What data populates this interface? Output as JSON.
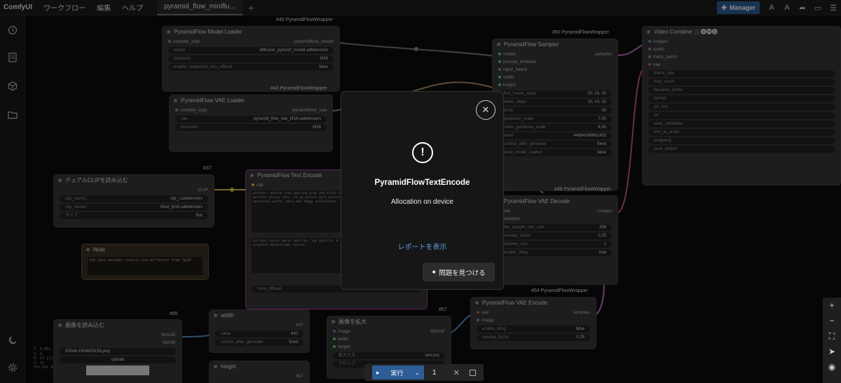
{
  "menubar": {
    "logo": "ComfyUI",
    "items": [
      "ワークフロー",
      "編集",
      "ヘルプ"
    ],
    "tab": "pyramid_flow_miniflu...",
    "plus": "+",
    "manager": "Manager"
  },
  "stats": [
    "T: 0.00s",
    "I: 0",
    "N: 13 [13]",
    "V: 31",
    "FPS:147.06"
  ],
  "nodes": {
    "model_loader": {
      "badge": "#40 PyramidFlowWrapper",
      "title": "PyramidFlow Model Loader",
      "in": "compile_args",
      "out": "pyramidflow_model",
      "w": [
        [
          "model",
          "diffusion_pytorch_model.safetensors"
        ],
        [
          "precision",
          "bf16"
        ],
        [
          "enable_sequential_cpu_offload",
          "false"
        ]
      ]
    },
    "vae_loader": {
      "badge": "#43 PyramidFlowWrapper",
      "title": "PyramidFlow VAE Loader",
      "in": "compile_args",
      "out": "pyramidflow_vae",
      "w": [
        [
          "vae",
          "pyramid_flow_vae_bf16.safetensors"
        ],
        [
          "precision",
          "bf16"
        ]
      ]
    },
    "dual_clip": {
      "badge": "#37",
      "title": "デュアルCLIPを読み込む",
      "out": "CLIP",
      "w": [
        [
          "clip_name1",
          "clip_l.safetensors"
        ],
        [
          "clip_name2",
          "t5xxl_fp16.safetensors"
        ],
        [
          "タイプ",
          "flux"
        ]
      ]
    },
    "text_encode": {
      "title": "PyramidFlow Text Encode",
      "in": "clip",
      "pos": "outdoor, medium shot,wearing gray and black cut hair), wide hip, large breasts, perfect glossy skin ,25 yo mature girl,picture of a asian beauty, Machine background , spaceship parts, dark and foggy environment, heavy fog",
      "neg": "cartoon style, worst quality, low quality, b low res, extra limbs, extra digits, misplace monochrome, horror",
      "w": "fcme_offload"
    },
    "note": {
      "title": "Note",
      "text": "fp8 text encoder results are different from fp16!"
    },
    "sampler": {
      "badge": "#50 PyramidFlowWrapper",
      "title": "PyramidFlow Sampler",
      "ins": [
        "model",
        "prompt_embeds",
        "input_latent",
        "width",
        "height"
      ],
      "out": "samples",
      "w": [
        [
          "first_frame_steps",
          "20, 20, 20"
        ],
        [
          "video_steps",
          "10, 10, 10"
        ],
        [
          "temp",
          "16"
        ],
        [
          "guidance_scale",
          "7.00"
        ],
        [
          "video_guidance_scale",
          "4.00"
        ],
        [
          "seed",
          "44664248661402"
        ],
        [
          "control_after_generate",
          "fixed"
        ],
        [
          "keep_model_loaded",
          "false"
        ]
      ]
    },
    "video_combine": {
      "title": "Video Combine 🎥🅥🅗🅢",
      "ins": [
        "images",
        "audio",
        "meta_batch",
        "vae"
      ],
      "w": [
        "frame_rate",
        "loop_count",
        "filename_prefix",
        "format",
        "pix_fmt",
        "crf",
        "save_metadata",
        "trim_to_audio",
        "pingpong",
        "save_output"
      ]
    },
    "vae_decode": {
      "badge": "#48 PyramidFlowWrapper",
      "title": "PyramidFlow VAE Decode",
      "ins": [
        "vae",
        "samples"
      ],
      "out": "images",
      "w": [
        [
          "tile_sample_min_size",
          "256"
        ],
        [
          "overlap_factor",
          "0.25"
        ],
        [
          "window_size",
          "1"
        ],
        [
          "enable_tiling",
          "true"
        ]
      ]
    },
    "vae_encode": {
      "badge": "#54 PyramidFlowWrapper",
      "title": "PyramidFlow VAE Encode",
      "ins": [
        "vae",
        "image"
      ],
      "out": "samples",
      "w": [
        [
          "enable_tiling",
          "false"
        ],
        [
          "overlap_factor",
          "0.25"
        ]
      ]
    },
    "load_image": {
      "badge": "#55",
      "title": "画像を読み込む",
      "outs": [
        "IMAGE",
        "MASK"
      ],
      "file": "00048-1904805155.png",
      "upload": "upload"
    },
    "width": {
      "title": "width",
      "out": "INT",
      "w": [
        [
          "value",
          "640"
        ],
        [
          "control_after_generate",
          "fixed"
        ]
      ]
    },
    "height": {
      "title": "height",
      "out": "INT"
    },
    "upscale": {
      "badge": "#57",
      "title": "画像を拡大",
      "ins": [
        "image",
        "width",
        "height"
      ],
      "out": "IMAGE",
      "w": [
        [
          "拡大方法",
          "lanczos"
        ],
        [
          "クロップ",
          ""
        ]
      ]
    }
  },
  "dialog": {
    "title": "PyramidFlowTextEncode",
    "message": "Allocation on device",
    "report_link": "レポートを表示",
    "find_issues": "問題を見つける"
  },
  "runbar": {
    "run_label": "実行",
    "count": "1"
  }
}
